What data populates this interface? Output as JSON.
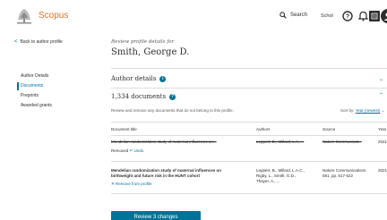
{
  "header": {
    "logo_text": "Scopus",
    "search_label": "Search",
    "scholar_label": "Schol",
    "icons": [
      "search-icon",
      "help-icon",
      "bell-icon",
      "institution-icon",
      "avatar-icon"
    ],
    "accent_color": "#e9711c"
  },
  "sidebar": {
    "back_label": "Back to author profile",
    "items": [
      {
        "label": "Author Details",
        "active": false
      },
      {
        "label": "Documents",
        "active": true
      },
      {
        "label": "Preprints",
        "active": false
      },
      {
        "label": "Awarded grants",
        "active": false
      }
    ]
  },
  "main": {
    "subtitle": "Review profile details for",
    "author_name": "Smith, George D.",
    "author_details_heading": "Author details",
    "documents_heading": "1,334 documents",
    "instructions": "Review and remove any documents that do not belong to this profile.",
    "sort_label": "Sort by:",
    "sort_value": "Year (newest)",
    "columns": [
      "Document title",
      "Authors",
      "Source",
      "Year"
    ],
    "rows": [
      {
        "title": "Mendelian randomization study of maternal influences on...",
        "authors": "Leppert, B., Millard, L.A.,...",
        "source": "Nature Communicat...",
        "year": "2021",
        "removed": true,
        "removed_label": "Removed",
        "undo_label": "Undo"
      },
      {
        "title_line1": "Mendelian randomization study of maternal influences on",
        "title_line2": "birthweight and future risk in the HUNT cohort",
        "authors_line1": "Leppert, B., Millard, L.A.C.,",
        "authors_line2": "Rigby, L., Smith, G.D.,",
        "authors_line3": "Thayer, A., ...",
        "source_line1": "Nature Communications",
        "source_line2": "581, pp. 517-522",
        "year": "2021",
        "removed": false,
        "remove_label": "Remove from profile"
      }
    ],
    "review_button": "Review 3 changes",
    "brand_color": "#007398"
  }
}
